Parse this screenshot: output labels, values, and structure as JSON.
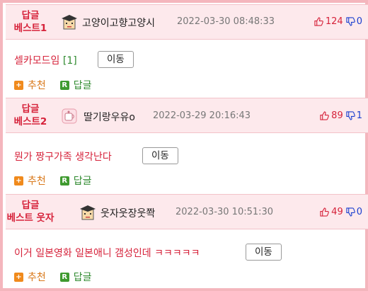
{
  "posts": [
    {
      "rank": [
        "답글",
        "베스트1"
      ],
      "nickname": "고양이고향고양시",
      "timestamp": "2022-03-30 08:48:33",
      "up_count": "124",
      "down_count": "0",
      "content": "셀카모드임",
      "comment_count": "[1]",
      "move_label": "이동",
      "recommend_label": "추천",
      "reply_label": "답글",
      "avatar_icon": "graduation-cap-avatar-icon"
    },
    {
      "rank": [
        "답글",
        "베스트2"
      ],
      "nickname": "딸기랑우유o",
      "timestamp": "2022-03-29 20:16:43",
      "up_count": "89",
      "down_count": "1",
      "content": "뭔가 짱구가족 생각난다",
      "comment_count": "",
      "move_label": "이동",
      "recommend_label": "추천",
      "reply_label": "답글",
      "avatar_icon": "cup-avatar-icon"
    },
    {
      "rank": [
        "답글",
        "베스트 웃자"
      ],
      "nickname": "웃자웃장웃쫙",
      "timestamp": "2022-03-30 10:51:30",
      "up_count": "49",
      "down_count": "0",
      "content": "이거 일본영화 일본애니 갬성인데 ㅋㅋㅋㅋㅋ",
      "comment_count": "",
      "move_label": "이동",
      "recommend_label": "추천",
      "reply_label": "답글",
      "avatar_icon": "graduation-cap-avatar-icon"
    }
  ],
  "badges": {
    "recommend": "+",
    "reply": "R"
  },
  "colors": {
    "accent_red": "#d6223a",
    "header_bg": "#fde9ec",
    "border_pink": "#f4b6bd",
    "green": "#2f8a2f",
    "orange": "#d9781a",
    "blue": "#1a3fcf"
  }
}
